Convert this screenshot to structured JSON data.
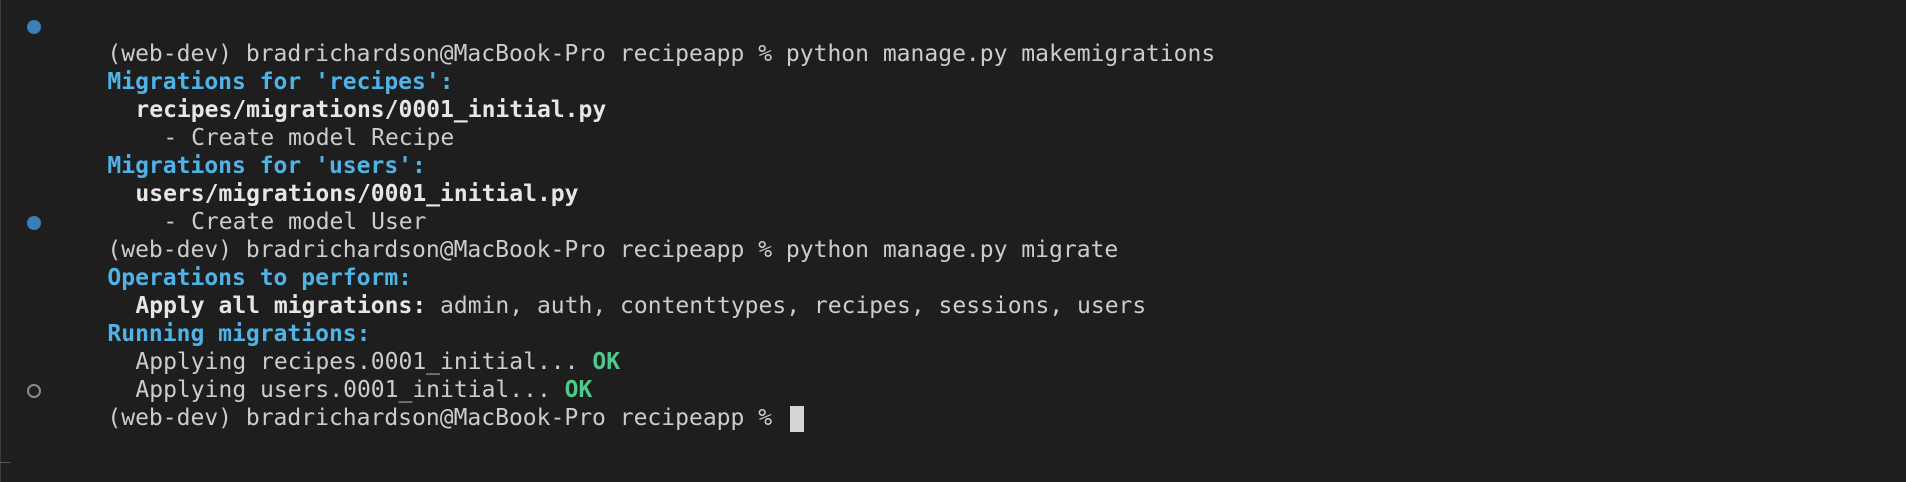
{
  "terminal": {
    "prompt": "(web-dev) bradrichardson@MacBook-Pro recipeapp % ",
    "lines": [
      {
        "command": "python manage.py makemigrations"
      },
      {
        "heading": "Migrations for 'recipes':"
      },
      {
        "file": "recipes/migrations/0001_initial.py"
      },
      {
        "text": "- Create model Recipe"
      },
      {
        "heading": "Migrations for 'users':"
      },
      {
        "file": "users/migrations/0001_initial.py"
      },
      {
        "text": "- Create model User"
      },
      {
        "command": "python manage.py migrate"
      },
      {
        "heading": "Operations to perform:"
      },
      {
        "label": "Apply all migrations:",
        "text": " admin, auth, contenttypes, recipes, sessions, users"
      },
      {
        "heading": "Running migrations:"
      },
      {
        "text": "Applying recipes.0001_initial... ",
        "status": "OK"
      },
      {
        "text": "Applying users.0001_initial... ",
        "status": "OK"
      }
    ]
  }
}
